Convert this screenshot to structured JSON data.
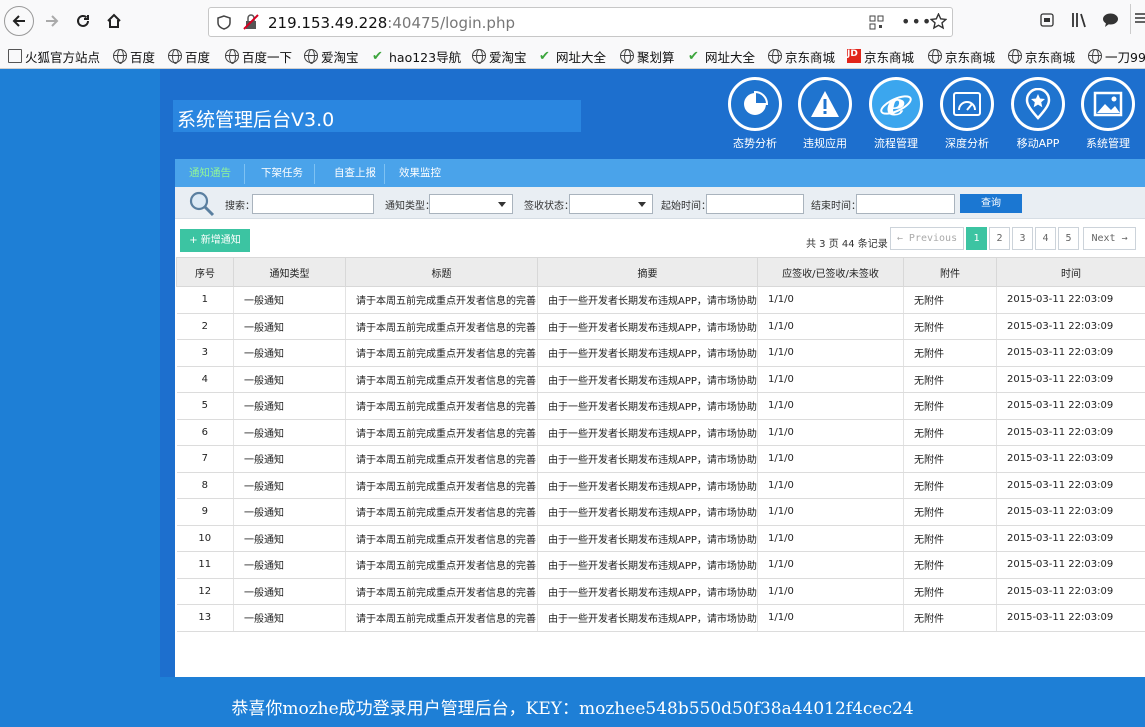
{
  "browser": {
    "url_host": "219.153.49.228",
    "url_rest": ":40475/login.php",
    "bookmarks": [
      {
        "label": "火狐官方站点",
        "icon": "folder-icon"
      },
      {
        "label": "百度",
        "icon": "globe-icon"
      },
      {
        "label": "百度",
        "icon": "globe-icon"
      },
      {
        "label": "百度一下",
        "icon": "globe-icon"
      },
      {
        "label": "爱淘宝",
        "icon": "globe-icon"
      },
      {
        "label": "hao123导航",
        "icon": "hao-icon"
      },
      {
        "label": "爱淘宝",
        "icon": "globe-icon"
      },
      {
        "label": "网址大全",
        "icon": "hao-icon"
      },
      {
        "label": "聚划算",
        "icon": "globe-icon"
      },
      {
        "label": "网址大全",
        "icon": "hao-icon"
      },
      {
        "label": "京东商城",
        "icon": "globe-icon"
      },
      {
        "label": "京东商城",
        "icon": "jd-icon"
      },
      {
        "label": "京东商城",
        "icon": "globe-icon"
      },
      {
        "label": "京东商城",
        "icon": "globe-icon"
      },
      {
        "label": "一刀99",
        "icon": "globe-icon"
      }
    ]
  },
  "app": {
    "title": "系统管理后台V3.0",
    "modules": [
      {
        "label": "态势分析",
        "icon": "pie-chart-icon"
      },
      {
        "label": "违规应用",
        "icon": "warning-icon"
      },
      {
        "label": "流程管理",
        "icon": "ie-logo-icon",
        "active": true
      },
      {
        "label": "深度分析",
        "icon": "gauge-icon"
      },
      {
        "label": "移动APP",
        "icon": "star-pin-icon"
      },
      {
        "label": "系统管理",
        "icon": "picture-icon"
      }
    ],
    "subtabs": [
      "通知通告",
      "下架任务",
      "自查上报",
      "效果监控"
    ],
    "active_subtab": "通知通告",
    "filters": {
      "search_label": "搜索：",
      "type_label": "通知类型：",
      "status_label": "签收状态：",
      "start_label": "起始时间：",
      "end_label": "结束时间：",
      "query_button": "查询"
    },
    "add_button": "新增通知",
    "total_text": "共 3 页 44 条记录",
    "pagination": {
      "prev": "← Previous",
      "pages": [
        "1",
        "2",
        "3",
        "4",
        "5"
      ],
      "current": "1",
      "next": "Next →"
    },
    "table": {
      "headers": [
        "序号",
        "通知类型",
        "标题",
        "摘要",
        "应签收/已签收/未签收",
        "附件",
        "时间"
      ],
      "rows": [
        [
          "1",
          "一般通知",
          "请于本周五前完成重点开发者信息的完善",
          "由于一些开发者长期发布违规APP，请市场协助…",
          "1/1/0",
          "无附件",
          "2015-03-11 22:03:09"
        ],
        [
          "2",
          "一般通知",
          "请于本周五前完成重点开发者信息的完善",
          "由于一些开发者长期发布违规APP，请市场协助…",
          "1/1/0",
          "无附件",
          "2015-03-11 22:03:09"
        ],
        [
          "3",
          "一般通知",
          "请于本周五前完成重点开发者信息的完善",
          "由于一些开发者长期发布违规APP，请市场协助…",
          "1/1/0",
          "无附件",
          "2015-03-11 22:03:09"
        ],
        [
          "4",
          "一般通知",
          "请于本周五前完成重点开发者信息的完善",
          "由于一些开发者长期发布违规APP，请市场协助…",
          "1/1/0",
          "无附件",
          "2015-03-11 22:03:09"
        ],
        [
          "5",
          "一般通知",
          "请于本周五前完成重点开发者信息的完善",
          "由于一些开发者长期发布违规APP，请市场协助…",
          "1/1/0",
          "无附件",
          "2015-03-11 22:03:09"
        ],
        [
          "6",
          "一般通知",
          "请于本周五前完成重点开发者信息的完善",
          "由于一些开发者长期发布违规APP，请市场协助…",
          "1/1/0",
          "无附件",
          "2015-03-11 22:03:09"
        ],
        [
          "7",
          "一般通知",
          "请于本周五前完成重点开发者信息的完善",
          "由于一些开发者长期发布违规APP，请市场协助…",
          "1/1/0",
          "无附件",
          "2015-03-11 22:03:09"
        ],
        [
          "8",
          "一般通知",
          "请于本周五前完成重点开发者信息的完善",
          "由于一些开发者长期发布违规APP，请市场协助…",
          "1/1/0",
          "无附件",
          "2015-03-11 22:03:09"
        ],
        [
          "9",
          "一般通知",
          "请于本周五前完成重点开发者信息的完善",
          "由于一些开发者长期发布违规APP，请市场协助…",
          "1/1/0",
          "无附件",
          "2015-03-11 22:03:09"
        ],
        [
          "10",
          "一般通知",
          "请于本周五前完成重点开发者信息的完善",
          "由于一些开发者长期发布违规APP，请市场协助…",
          "1/1/0",
          "无附件",
          "2015-03-11 22:03:09"
        ],
        [
          "11",
          "一般通知",
          "请于本周五前完成重点开发者信息的完善",
          "由于一些开发者长期发布违规APP，请市场协助…",
          "1/1/0",
          "无附件",
          "2015-03-11 22:03:09"
        ],
        [
          "12",
          "一般通知",
          "请于本周五前完成重点开发者信息的完善",
          "由于一些开发者长期发布违规APP，请市场协助…",
          "1/1/0",
          "无附件",
          "2015-03-11 22:03:09"
        ],
        [
          "13",
          "一般通知",
          "请于本周五前完成重点开发者信息的完善",
          "由于一些开发者长期发布违规APP，请市场协助…",
          "1/1/0",
          "无附件",
          "2015-03-11 22:03:09"
        ]
      ]
    }
  },
  "footer": {
    "message": "恭喜你mozhe成功登录用户管理后台，KEY：mozhee548b550d50f38a44012f4cec24"
  }
}
